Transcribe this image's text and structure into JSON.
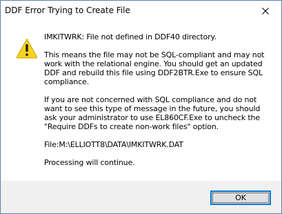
{
  "window": {
    "title": "DDF Error Trying to Create File",
    "close_icon": "close-icon",
    "warning_icon": "warning-icon"
  },
  "message": {
    "heading": "IMKITWRK: File not defined in DDF40 directory.",
    "para1": [
      "This means the file may not be SQL-compliant and may not",
      "work with the relational engine.  You should get an updated",
      "DDF and rebuild this file using DDF2BTR.Exe to ensure SQL",
      "compliance."
    ],
    "para2": [
      "If you are not concerned with SQL compliance and do not",
      "want to see this type of message in the future, you should",
      "ask your administrator to use EL860CF.Exe to uncheck the",
      "\"Require DDFs to create non-work files\" option."
    ],
    "file_path": "File:M:\\ELLIOTT8\\DATA\\IMKITWRK.DAT",
    "footer_note": "Processing will continue."
  },
  "buttons": {
    "ok_label": "OK"
  },
  "colors": {
    "warning_yellow": "#f9d21c",
    "focus_blue": "#0078d7",
    "window_border": "#5a7fae"
  }
}
